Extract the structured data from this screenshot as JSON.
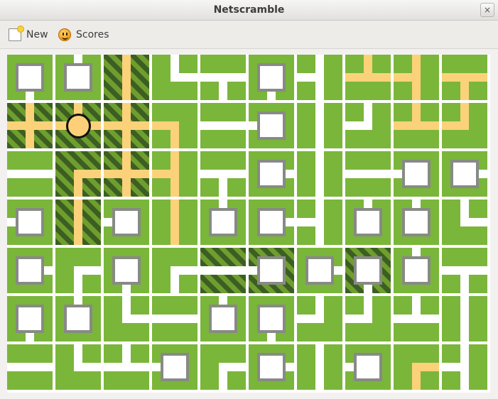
{
  "window": {
    "title": "Netscramble",
    "close_label": "×"
  },
  "toolbar": {
    "new_label": "New",
    "scores_label": "Scores"
  },
  "board": {
    "columns": 10,
    "rows": 7,
    "tiles": [
      [
        {
          "c": "s",
          "t": "box"
        },
        {
          "c": "n",
          "t": "box"
        },
        {
          "c": "ns",
          "root": true,
          "on": true
        },
        {
          "c": "ne"
        },
        {
          "c": "ews"
        },
        {
          "c": "s",
          "t": "box"
        },
        {
          "c": "nsw"
        },
        {
          "c": "new",
          "on": true
        },
        {
          "c": "nsw",
          "on": true
        },
        {
          "c": "ews",
          "on": true
        }
      ],
      [
        {
          "c": "nesw",
          "root": true,
          "on": true
        },
        {
          "c": "new",
          "root": true,
          "on": true,
          "t": "server"
        },
        {
          "c": "nesw",
          "root": true,
          "on": true
        },
        {
          "c": "sw",
          "on": true
        },
        {
          "c": "ew"
        },
        {
          "c": "w",
          "t": "box"
        },
        {
          "c": "ns"
        },
        {
          "c": "nw"
        },
        {
          "c": "new",
          "on": true
        },
        {
          "c": "nw",
          "on": true
        }
      ],
      [
        {
          "c": "ew"
        },
        {
          "c": "es",
          "root": true,
          "on": true
        },
        {
          "c": "nesw",
          "root": true,
          "on": true
        },
        {
          "c": "nsw",
          "on": true
        },
        {
          "c": "ews"
        },
        {
          "c": "e",
          "t": "box"
        },
        {
          "c": "ns"
        },
        {
          "c": "ew"
        },
        {
          "c": "w",
          "t": "box"
        },
        {
          "c": "e",
          "t": "box"
        }
      ],
      [
        {
          "c": "w",
          "t": "box"
        },
        {
          "c": "ns",
          "root": true,
          "on": true
        },
        {
          "c": "w",
          "t": "box"
        },
        {
          "c": "ns",
          "on": true
        },
        {
          "c": "n",
          "t": "box"
        },
        {
          "c": "e",
          "t": "box"
        },
        {
          "c": "nsw"
        },
        {
          "c": "n",
          "t": "box"
        },
        {
          "c": "n",
          "t": "box"
        },
        {
          "c": "ne"
        }
      ],
      [
        {
          "c": "e",
          "t": "box"
        },
        {
          "c": "es"
        },
        {
          "c": "s",
          "t": "box"
        },
        {
          "c": "es"
        },
        {
          "c": "ew",
          "root": true
        },
        {
          "c": "w",
          "t": "box",
          "root": true
        },
        {
          "c": "e",
          "t": "box"
        },
        {
          "c": "s",
          "t": "box",
          "root": true
        },
        {
          "c": "n",
          "t": "box"
        },
        {
          "c": "ews"
        }
      ],
      [
        {
          "c": "s",
          "t": "box"
        },
        {
          "c": "n",
          "t": "box"
        },
        {
          "c": "ne"
        },
        {
          "c": "ew"
        },
        {
          "c": "n",
          "t": "box"
        },
        {
          "c": "s",
          "t": "box"
        },
        {
          "c": "nw"
        },
        {
          "c": "nw"
        },
        {
          "c": "new"
        },
        {
          "c": "ns"
        }
      ],
      [
        {
          "c": "ew"
        },
        {
          "c": "ne"
        },
        {
          "c": "new"
        },
        {
          "c": "w",
          "t": "box"
        },
        {
          "c": "es"
        },
        {
          "c": "e",
          "t": "box"
        },
        {
          "c": "ns"
        },
        {
          "c": "w",
          "t": "box"
        },
        {
          "c": "es",
          "on": true
        },
        {
          "c": "nsw"
        }
      ]
    ]
  },
  "colors": {
    "tile_green": "#7ab63a",
    "pipe_unpowered": "#ffffff",
    "pipe_powered": "#fbd27a",
    "root_stripe_dark": "#3d5e22",
    "box_border": "#888a85"
  },
  "icons": {
    "new": "new-document-icon",
    "scores": "smiley-icon",
    "close": "close-icon"
  }
}
